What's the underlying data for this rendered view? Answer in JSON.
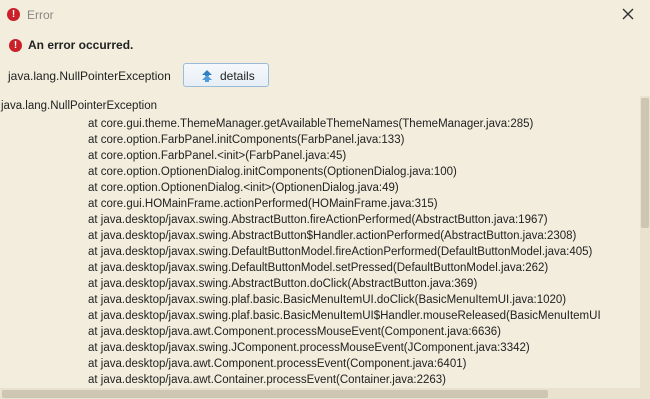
{
  "window": {
    "title": "Error",
    "close_label": "✕"
  },
  "dialog": {
    "heading": "An error occurred.",
    "exception_name": "java.lang.NullPointerException",
    "details_label": "details"
  },
  "icons": {
    "error": "error-circle-icon",
    "details": "collapse-up-icon",
    "close": "close-icon"
  },
  "colors": {
    "background": "#f2eddd",
    "error_red": "#c9202a",
    "button_border": "#9bbcd6"
  },
  "trace": {
    "first_line": "java.lang.NullPointerException",
    "lines": [
      "at core.gui.theme.ThemeManager.getAvailableThemeNames(ThemeManager.java:285)",
      "at core.option.FarbPanel.initComponents(FarbPanel.java:133)",
      "at core.option.FarbPanel.<init>(FarbPanel.java:45)",
      "at core.option.OptionenDialog.initComponents(OptionenDialog.java:100)",
      "at core.option.OptionenDialog.<init>(OptionenDialog.java:49)",
      "at core.gui.HOMainFrame.actionPerformed(HOMainFrame.java:315)",
      "at java.desktop/javax.swing.AbstractButton.fireActionPerformed(AbstractButton.java:1967)",
      "at java.desktop/javax.swing.AbstractButton$Handler.actionPerformed(AbstractButton.java:2308)",
      "at java.desktop/javax.swing.DefaultButtonModel.fireActionPerformed(DefaultButtonModel.java:405)",
      "at java.desktop/javax.swing.DefaultButtonModel.setPressed(DefaultButtonModel.java:262)",
      "at java.desktop/javax.swing.AbstractButton.doClick(AbstractButton.java:369)",
      "at java.desktop/javax.swing.plaf.basic.BasicMenuItemUI.doClick(BasicMenuItemUI.java:1020)",
      "at java.desktop/javax.swing.plaf.basic.BasicMenuItemUI$Handler.mouseReleased(BasicMenuItemUI",
      "at java.desktop/java.awt.Component.processMouseEvent(Component.java:6636)",
      "at java.desktop/javax.swing.JComponent.processMouseEvent(JComponent.java:3342)",
      "at java.desktop/java.awt.Component.processEvent(Component.java:6401)",
      "at java.desktop/java.awt.Container.processEvent(Container.java:2263)"
    ]
  }
}
